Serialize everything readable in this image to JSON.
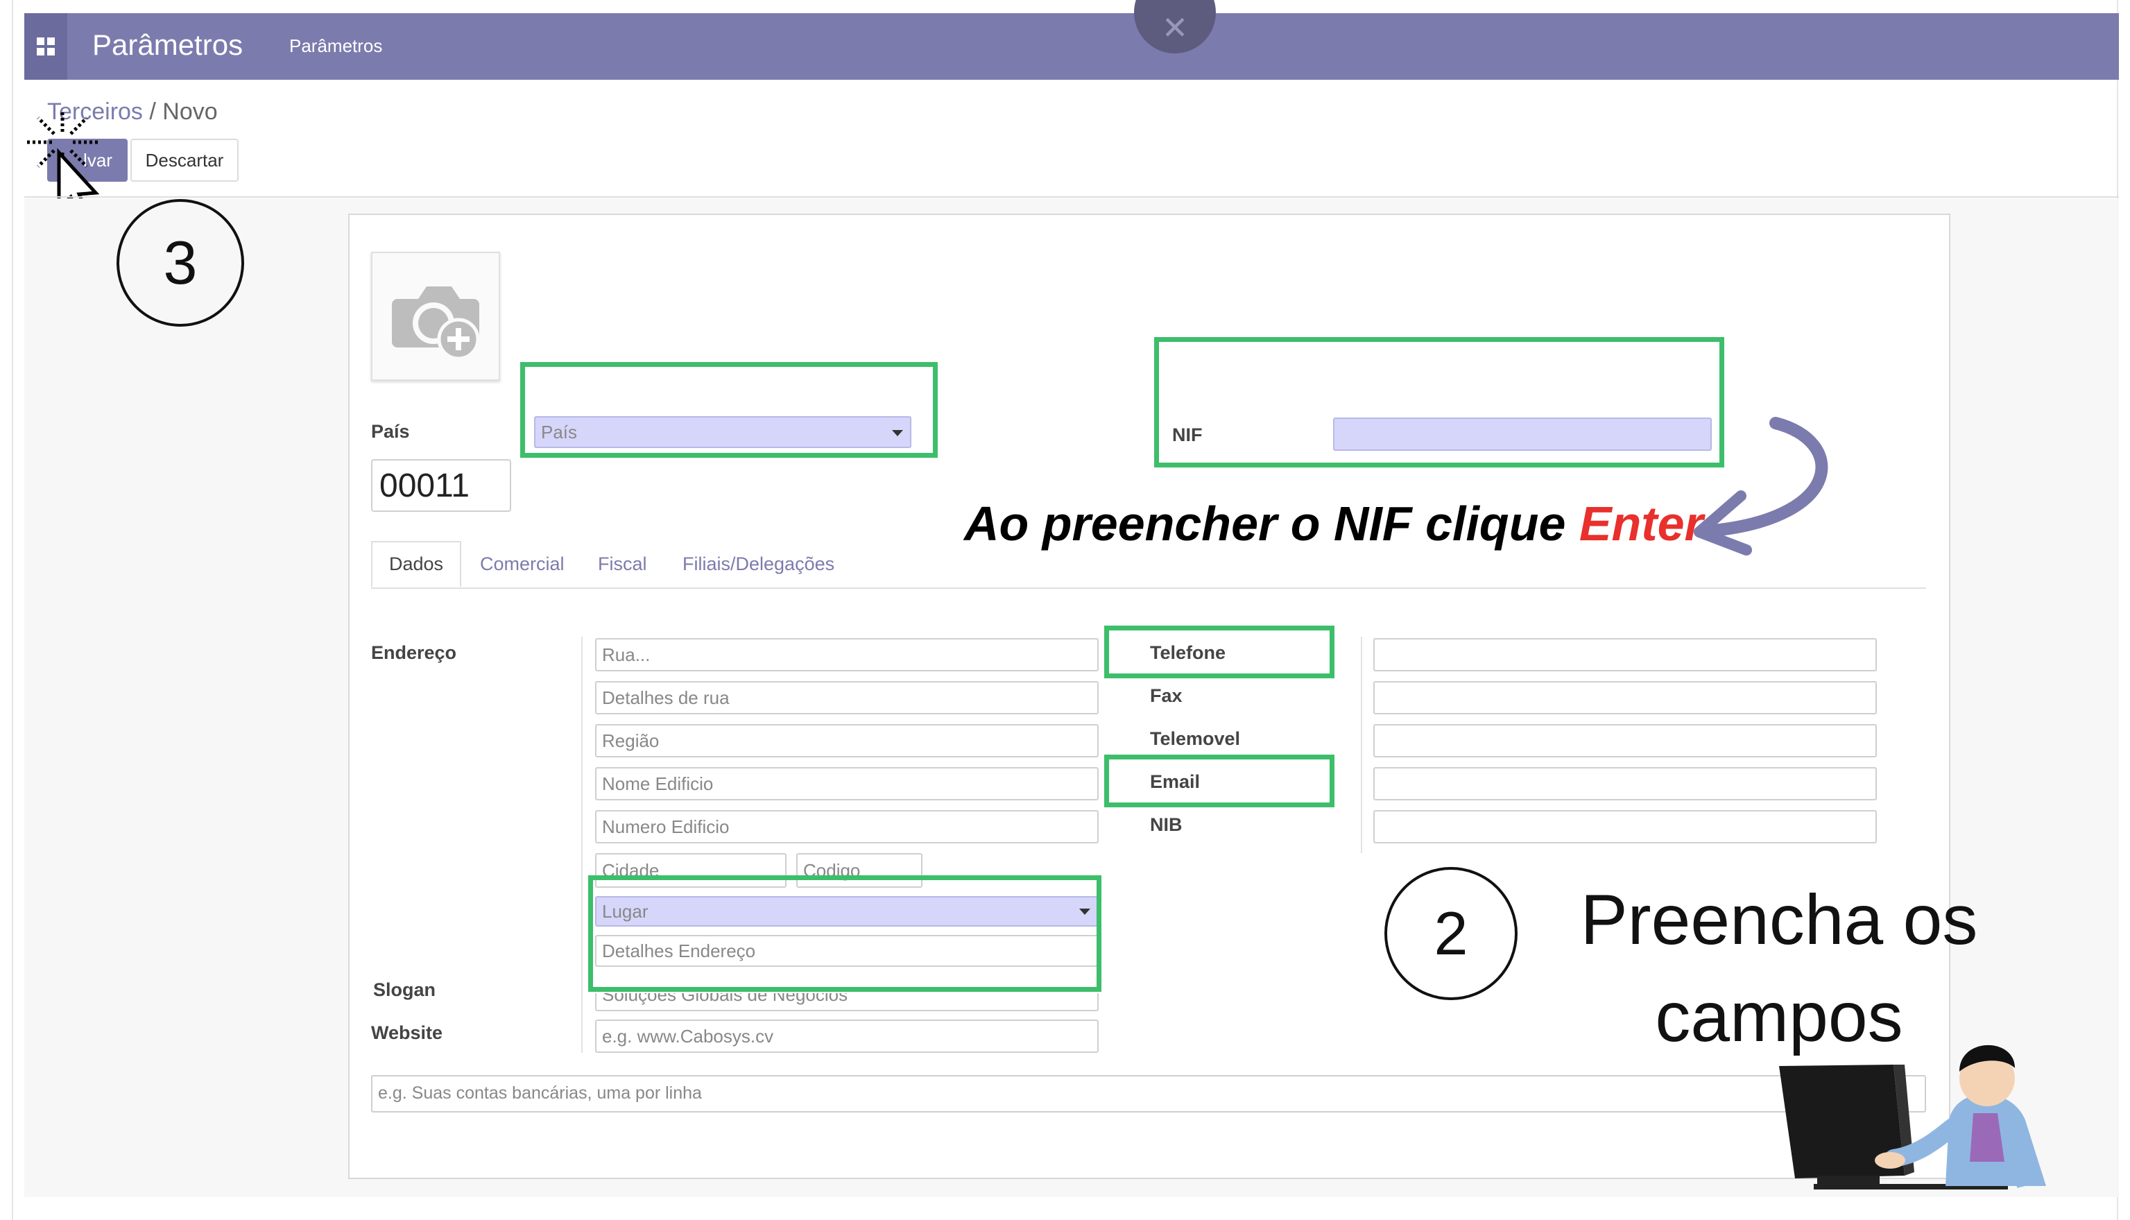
{
  "app": {
    "title": "Parâmetros",
    "menu_item": "Parâmetros",
    "close_glyph": "✕"
  },
  "breadcrumb": {
    "parent": "Terceiros",
    "separator": " / ",
    "current": "Novo"
  },
  "toolbar": {
    "save_label": "lvar",
    "discard_label": "Descartar"
  },
  "form": {
    "pais_label": "País",
    "pais_placeholder": "País",
    "nif_label": "NIF",
    "code_value": "00011",
    "tabs": [
      {
        "label": "Dados"
      },
      {
        "label": "Comercial"
      },
      {
        "label": "Fiscal"
      },
      {
        "label": "Filiais/Delegações"
      }
    ],
    "address_label": "Endereço",
    "address_placeholders": {
      "rua": "Rua...",
      "detalhes_rua": "Detalhes de rua",
      "regiao": "Região",
      "nome_edificio": "Nome Edificio",
      "numero_edificio": "Numero Edificio",
      "cidade": "Cidade",
      "codigo": "Codigo",
      "lugar": "Lugar",
      "detalhes_endereco": "Detalhes Endereço"
    },
    "contact_labels": {
      "telefone": "Telefone",
      "fax": "Fax",
      "telemovel": "Telemovel",
      "email": "Email",
      "nib": "NIB"
    },
    "slogan_label": "Slogan",
    "slogan_placeholder": "Soluções Globais de Negócios",
    "website_label": "Website",
    "website_placeholder": "e.g. www.Cabosys.cv",
    "bank_placeholder": "e.g. Suas contas bancárias, uma por linha"
  },
  "annotations": {
    "enter_text": "Ao preencher o NIF clique ",
    "enter_highlight": "Enter",
    "step2_number": "2",
    "step2_text_line1": "Preencha os",
    "step2_text_line2": "campos",
    "step3_number": "3"
  },
  "colors": {
    "topbar": "#7c7bad",
    "highlight_box": "#3dbe6a",
    "active_field": "#d6d6fb",
    "enter_red": "#e8302c"
  },
  "icons": [
    "apps-icon",
    "camera-add-icon",
    "dropdown-caret-icon",
    "cursor-icon",
    "curved-arrow-icon",
    "person-at-computer-illustration"
  ]
}
